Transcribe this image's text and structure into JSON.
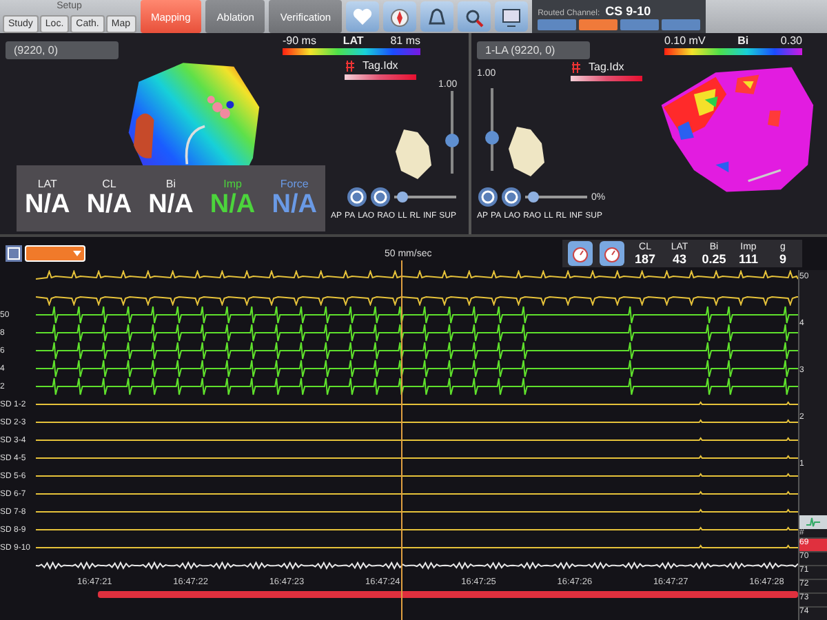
{
  "toolbar": {
    "setup_label": "Setup",
    "setup_tabs": [
      {
        "label": "Study",
        "selected": false
      },
      {
        "label": "Loc.",
        "selected": false
      },
      {
        "label": "Cath.",
        "selected": false
      },
      {
        "label": "Map",
        "selected": false
      }
    ],
    "main_tabs": [
      {
        "label": "Mapping",
        "selected": true
      },
      {
        "label": "Ablation",
        "selected": false
      },
      {
        "label": "Verification",
        "selected": false
      }
    ],
    "routed_channel": {
      "label": "Routed Channel:",
      "value": "CS 9-10",
      "buttons": [
        {
          "selected": false
        },
        {
          "selected": true
        },
        {
          "selected": false
        },
        {
          "selected": false
        }
      ]
    }
  },
  "maps": [
    {
      "map_name": "(9220, 0)",
      "scale": {
        "kind": "lat",
        "min": "-90 ms",
        "title": "LAT",
        "max": "81 ms"
      },
      "tag_label": "Tag.Idx",
      "opacity_value": "1.00",
      "vertical_slider": {
        "level": 0.4
      },
      "zoom_slider": {
        "level": 0.05
      },
      "views": [
        "AP",
        "PA",
        "LAO",
        "RAO",
        "LL",
        "RL",
        "INF",
        "SUP"
      ]
    },
    {
      "map_name": "1-LA (9220, 0)",
      "scale": {
        "kind": "bipolar",
        "min": "0.10 mV",
        "title": "Bi",
        "max": "0.30"
      },
      "tag_label": "Tag.Idx",
      "opacity_value": "1.00",
      "vertical_slider": {
        "level": 0.4
      },
      "zoom_slider": {
        "level": 0.05
      },
      "percent": "0%",
      "views": [
        "AP",
        "PA",
        "LAO",
        "RAO",
        "LL",
        "RL",
        "INF",
        "SUP"
      ]
    }
  ],
  "readout": [
    {
      "label": "LAT",
      "value": "N/A",
      "color": "#ffffff"
    },
    {
      "label": "CL",
      "value": "N/A",
      "color": "#ffffff"
    },
    {
      "label": "Bi",
      "value": "N/A",
      "color": "#ffffff"
    },
    {
      "label": "Imp",
      "value": "N/A",
      "color": "#4cd43c"
    },
    {
      "label": "Force",
      "value": "N/A",
      "color": "#6a9ae6"
    }
  ],
  "traces_header": {
    "speed": "50 mm/sec",
    "readings": [
      {
        "label": "CL",
        "value": "187"
      },
      {
        "label": "LAT",
        "value": "43"
      },
      {
        "label": "Bi",
        "value": "0.25"
      },
      {
        "label": "Imp",
        "value": "111"
      },
      {
        "label": "g",
        "value": "9"
      }
    ]
  },
  "traces": [
    {
      "kind": "surface",
      "color": "#e6c23a"
    },
    {
      "kind": "surface",
      "color": "#e6c23a"
    },
    {
      "label": "50",
      "kind": "spikes",
      "color": "#5fe02c"
    },
    {
      "label": "8",
      "kind": "spikes",
      "color": "#5fe02c"
    },
    {
      "label": "6",
      "kind": "spikes",
      "color": "#5fe02c"
    },
    {
      "label": "4",
      "kind": "spikes",
      "color": "#5fe02c"
    },
    {
      "label": "2",
      "kind": "spikes",
      "color": "#5fe02c"
    },
    {
      "label": "SD 1-2",
      "kind": "flat",
      "color": "#e6c23a"
    },
    {
      "label": "SD 2-3",
      "kind": "flat",
      "color": "#e6c23a"
    },
    {
      "label": "SD 3-4",
      "kind": "flat",
      "color": "#e6c23a"
    },
    {
      "label": "SD 4-5",
      "kind": "flat",
      "color": "#e6c23a"
    },
    {
      "label": "SD 5-6",
      "kind": "flat",
      "color": "#e6c23a"
    },
    {
      "label": "SD 6-7",
      "kind": "flat",
      "color": "#e6c23a"
    },
    {
      "label": "SD 7-8",
      "kind": "flat",
      "color": "#e6c23a"
    },
    {
      "label": "SD 8-9",
      "kind": "flat",
      "color": "#e6c23a"
    },
    {
      "label": "SD 9-10",
      "kind": "flat",
      "color": "#e6c23a"
    },
    {
      "kind": "noise",
      "color": "#e8e8e8"
    }
  ],
  "time_labels": [
    "16:47:21",
    "16:47:22",
    "16:47:23",
    "16:47:24",
    "16:47:25",
    "16:47:26",
    "16:47:27",
    "16:47:28"
  ],
  "scale_labels": [
    "50",
    "4",
    "3",
    "2",
    "1"
  ],
  "point_list": {
    "header": "#",
    "items": [
      {
        "label": "69",
        "selected": true
      },
      {
        "label": "70",
        "selected": false
      },
      {
        "label": "71",
        "selected": false
      },
      {
        "label": "72",
        "selected": false
      },
      {
        "label": "73",
        "selected": false
      },
      {
        "label": "74",
        "selected": false
      }
    ]
  }
}
